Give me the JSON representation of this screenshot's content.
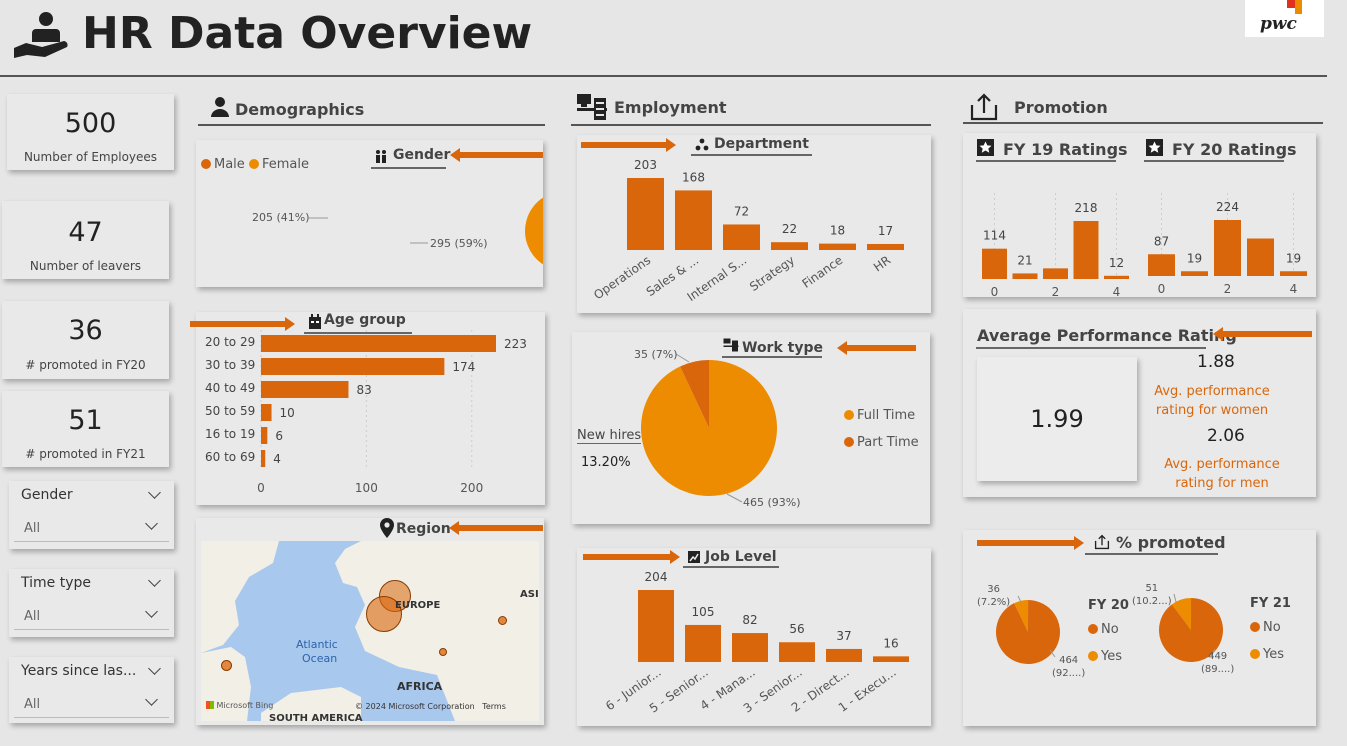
{
  "header": {
    "title": "HR Data Overview",
    "logo_text": "pwc"
  },
  "kpis": [
    {
      "value": "500",
      "label": "Number of Employees"
    },
    {
      "value": "47",
      "label": "Number of leavers"
    },
    {
      "value": "36",
      "label": "# promoted in FY20"
    },
    {
      "value": "51",
      "label": "# promoted in FY21"
    }
  ],
  "slicers": [
    {
      "title": "Gender",
      "value": "All"
    },
    {
      "title": "Time type",
      "value": "All"
    },
    {
      "title": "Years since las...",
      "value": "All"
    }
  ],
  "sections": {
    "demographics": "Demographics",
    "employment": "Employment",
    "promotion": "Promotion"
  },
  "gender": {
    "title": "Gender",
    "legend": [
      "Male",
      "Female"
    ],
    "labels": [
      "205 (41%)",
      "295 (59%)"
    ]
  },
  "age_group": {
    "title": "Age group",
    "categories": [
      "20 to 29",
      "30 to 39",
      "40 to 49",
      "50 to 59",
      "16 to 19",
      "60 to 69"
    ],
    "values": [
      223,
      174,
      83,
      10,
      6,
      4
    ],
    "ticks": [
      "0",
      "100",
      "200"
    ]
  },
  "region": {
    "title": "Region",
    "map_labels": [
      "EUROPE",
      "ASI",
      "Atlantic",
      "Ocean",
      "AFRICA",
      "SOUTH AMERICA"
    ],
    "attribution": "Microsoft Bing",
    "copyright": "© 2024 Microsoft Corporation",
    "terms": "Terms"
  },
  "department": {
    "title": "Department",
    "categories": [
      "Operations",
      "Sales & ...",
      "Internal S...",
      "Strategy",
      "Finance",
      "HR"
    ],
    "values": [
      203,
      168,
      72,
      22,
      18,
      17
    ]
  },
  "work_type": {
    "title": "Work type",
    "legend": [
      "Full Time",
      "Part Time"
    ],
    "labels": [
      "35 (7%)",
      "465 (93%)"
    ],
    "new_hires_label": "New hires",
    "new_hires_value": "13.20%"
  },
  "job_level": {
    "title": "Job Level",
    "categories": [
      "6 - Junior...",
      "5 - Senior...",
      "4 - Mana...",
      "3 - Senior...",
      "2 - Direct...",
      "1 - Execu..."
    ],
    "values": [
      204,
      105,
      82,
      56,
      37,
      16
    ]
  },
  "fy19": {
    "title": "FY 19 Ratings",
    "values": [
      114,
      21,
      40,
      218,
      12
    ],
    "value_labels": [
      "114",
      "21",
      "",
      "218",
      "12"
    ],
    "ticks": [
      "0",
      "2",
      "4"
    ]
  },
  "fy20": {
    "title": "FY 20 Ratings",
    "values": [
      87,
      19,
      224,
      150,
      19
    ],
    "value_labels": [
      "87",
      "19",
      "224",
      "",
      "19"
    ],
    "ticks": [
      "0",
      "2",
      "4"
    ]
  },
  "avg_perf": {
    "title": "Average Performance Rating",
    "overall": "1.99",
    "women_value": "1.88",
    "women_label_1": "Avg. performance",
    "women_label_2": "rating for women",
    "men_value": "2.06",
    "men_label_1": "Avg. performance",
    "men_label_2": "rating for men"
  },
  "pct_promoted": {
    "title": "% promoted",
    "fy20": {
      "title": "FY 20",
      "legend": [
        "No",
        "Yes"
      ],
      "yes_label_1": "36",
      "yes_label_2": "(7.2%)",
      "no_label_1": "464",
      "no_label_2": "(92....)"
    },
    "fy21": {
      "title": "FY 21",
      "legend": [
        "No",
        "Yes"
      ],
      "yes_label_1": "51",
      "yes_label_2": "(10.2...)",
      "no_label_1": "449",
      "no_label_2": "(89....)"
    }
  },
  "chart_data": [
    {
      "type": "pie",
      "title": "Gender",
      "categories": [
        "Male",
        "Female"
      ],
      "values": [
        295,
        205
      ]
    },
    {
      "type": "bar",
      "title": "Age group",
      "categories": [
        "20 to 29",
        "30 to 39",
        "40 to 49",
        "50 to 59",
        "16 to 19",
        "60 to 69"
      ],
      "values": [
        223,
        174,
        83,
        10,
        6,
        4
      ]
    },
    {
      "type": "bar",
      "title": "Department",
      "categories": [
        "Operations",
        "Sales & ...",
        "Internal S...",
        "Strategy",
        "Finance",
        "HR"
      ],
      "values": [
        203,
        168,
        72,
        22,
        18,
        17
      ]
    },
    {
      "type": "pie",
      "title": "Work type",
      "categories": [
        "Full Time",
        "Part Time"
      ],
      "values": [
        465,
        35
      ]
    },
    {
      "type": "bar",
      "title": "Job Level",
      "categories": [
        "6 - Junior...",
        "5 - Senior...",
        "4 - Mana...",
        "3 - Senior...",
        "2 - Direct...",
        "1 - Execu..."
      ],
      "values": [
        204,
        105,
        82,
        56,
        37,
        16
      ]
    },
    {
      "type": "bar",
      "title": "FY 19 Ratings",
      "x": [
        0,
        1,
        2,
        3,
        4
      ],
      "values": [
        114,
        21,
        40,
        218,
        12
      ]
    },
    {
      "type": "bar",
      "title": "FY 20 Ratings",
      "x": [
        0,
        1,
        2,
        3,
        4
      ],
      "values": [
        87,
        19,
        224,
        150,
        19
      ]
    },
    {
      "type": "pie",
      "title": "FY 20",
      "categories": [
        "No",
        "Yes"
      ],
      "values": [
        464,
        36
      ]
    },
    {
      "type": "pie",
      "title": "FY 21",
      "categories": [
        "No",
        "Yes"
      ],
      "values": [
        449,
        51
      ]
    }
  ]
}
